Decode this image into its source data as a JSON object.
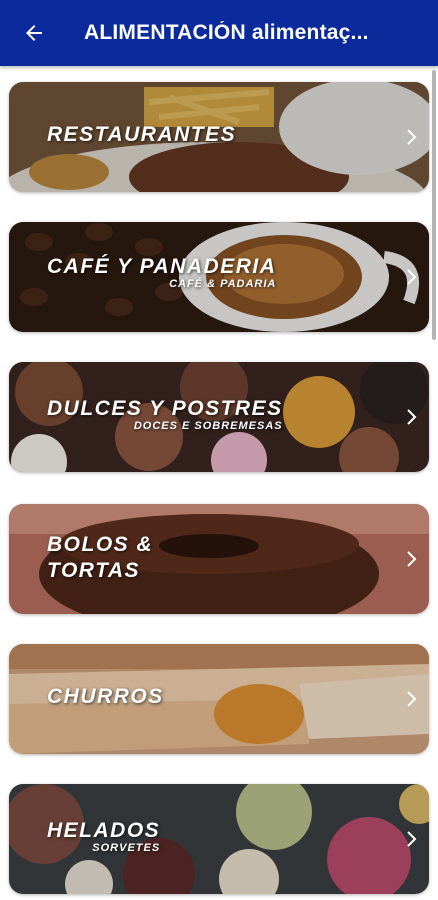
{
  "appbar": {
    "title": "ALIMENTACIÓN alimentaç...",
    "back_icon": "arrow-left-icon",
    "color": "#0b2a9c"
  },
  "categories": [
    {
      "id": "restaurantes",
      "title_line1": "RESTAURANTES",
      "title_line2": "",
      "subtitle": ""
    },
    {
      "id": "cafe",
      "title_line1": "CAFÉ Y PANADERIA",
      "title_line2": "",
      "subtitle": "CAFÉ & PADARIA"
    },
    {
      "id": "dulces",
      "title_line1": "DULCES Y POSTRES",
      "title_line2": "",
      "subtitle": "DOCES E SOBREMESAS"
    },
    {
      "id": "bolos",
      "title_line1": "BOLOS &",
      "title_line2": "TORTAS",
      "subtitle": ""
    },
    {
      "id": "churros",
      "title_line1": "CHURROS",
      "title_line2": "",
      "subtitle": ""
    },
    {
      "id": "helados",
      "title_line1": "HELADOS",
      "title_line2": "",
      "subtitle": "SORVETES"
    }
  ]
}
